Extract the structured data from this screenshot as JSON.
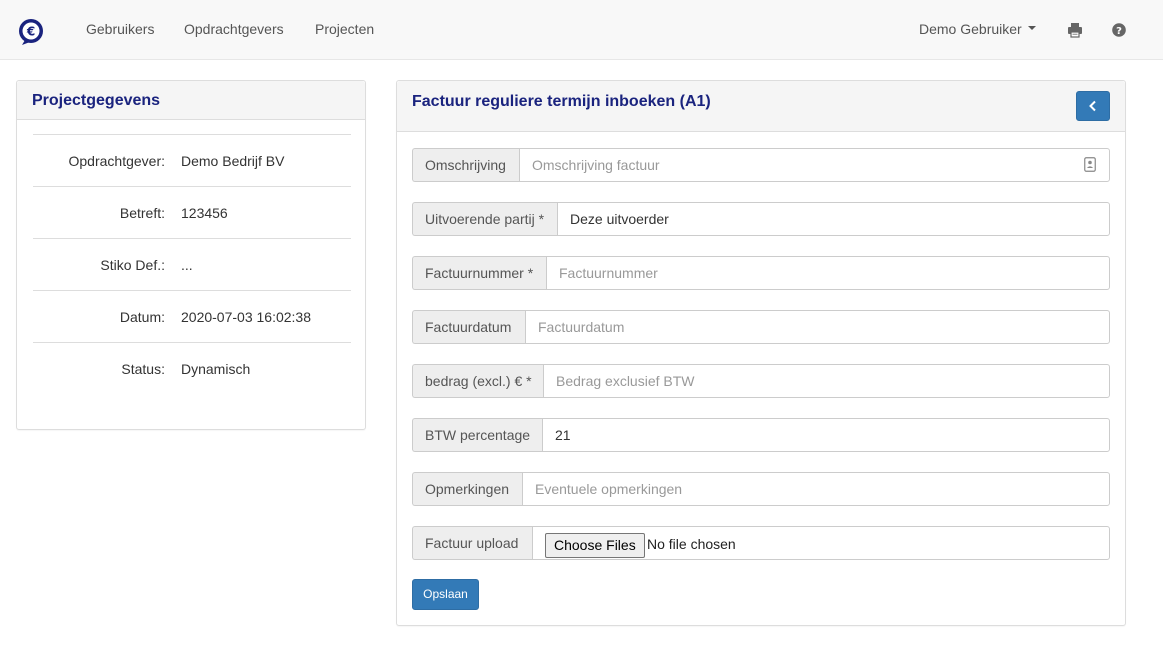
{
  "navbar": {
    "brand_symbol": "€",
    "links": [
      "Gebruikers",
      "Opdrachtgevers",
      "Projecten"
    ],
    "user_menu": "Demo Gebruiker",
    "icons": [
      "print-icon",
      "help-icon"
    ]
  },
  "project_panel": {
    "title": "Projectgegevens",
    "rows": [
      {
        "label": "Opdrachtgever:",
        "value": "Demo Bedrijf BV"
      },
      {
        "label": "Betreft:",
        "value": "123456"
      },
      {
        "label": "Stiko Def.:",
        "value": "..."
      },
      {
        "label": "Datum:",
        "value": "2020-07-03 16:02:38"
      },
      {
        "label": "Status:",
        "value": "Dynamisch"
      }
    ]
  },
  "invoice_panel": {
    "title": "Factuur reguliere termijn inboeken (A1)",
    "fields": {
      "omschrijving": {
        "label": "Omschrijving",
        "value": "",
        "placeholder": "Omschrijving factuur"
      },
      "uitvoerende_partij": {
        "label": "Uitvoerende partij *",
        "value": "Deze uitvoerder",
        "placeholder": ""
      },
      "factuurnummer": {
        "label": "Factuurnummer *",
        "value": "",
        "placeholder": "Factuurnummer"
      },
      "factuurdatum": {
        "label": "Factuurdatum",
        "value": "",
        "placeholder": "Factuurdatum"
      },
      "bedrag": {
        "label": "bedrag (excl.) € *",
        "value": "",
        "placeholder": "Bedrag exclusief BTW"
      },
      "btw_percentage": {
        "label": "BTW percentage",
        "value": "21",
        "placeholder": ""
      },
      "opmerkingen": {
        "label": "Opmerkingen",
        "value": "",
        "placeholder": "Eventuele opmerkingen"
      },
      "factuur_upload": {
        "label": "Factuur upload",
        "button": "Choose Files",
        "status": "No file chosen"
      }
    },
    "save_label": "Opslaan"
  },
  "colors": {
    "primary": "#337ab7",
    "title": "#1a237e",
    "navbar_bg": "#f8f8f8"
  }
}
